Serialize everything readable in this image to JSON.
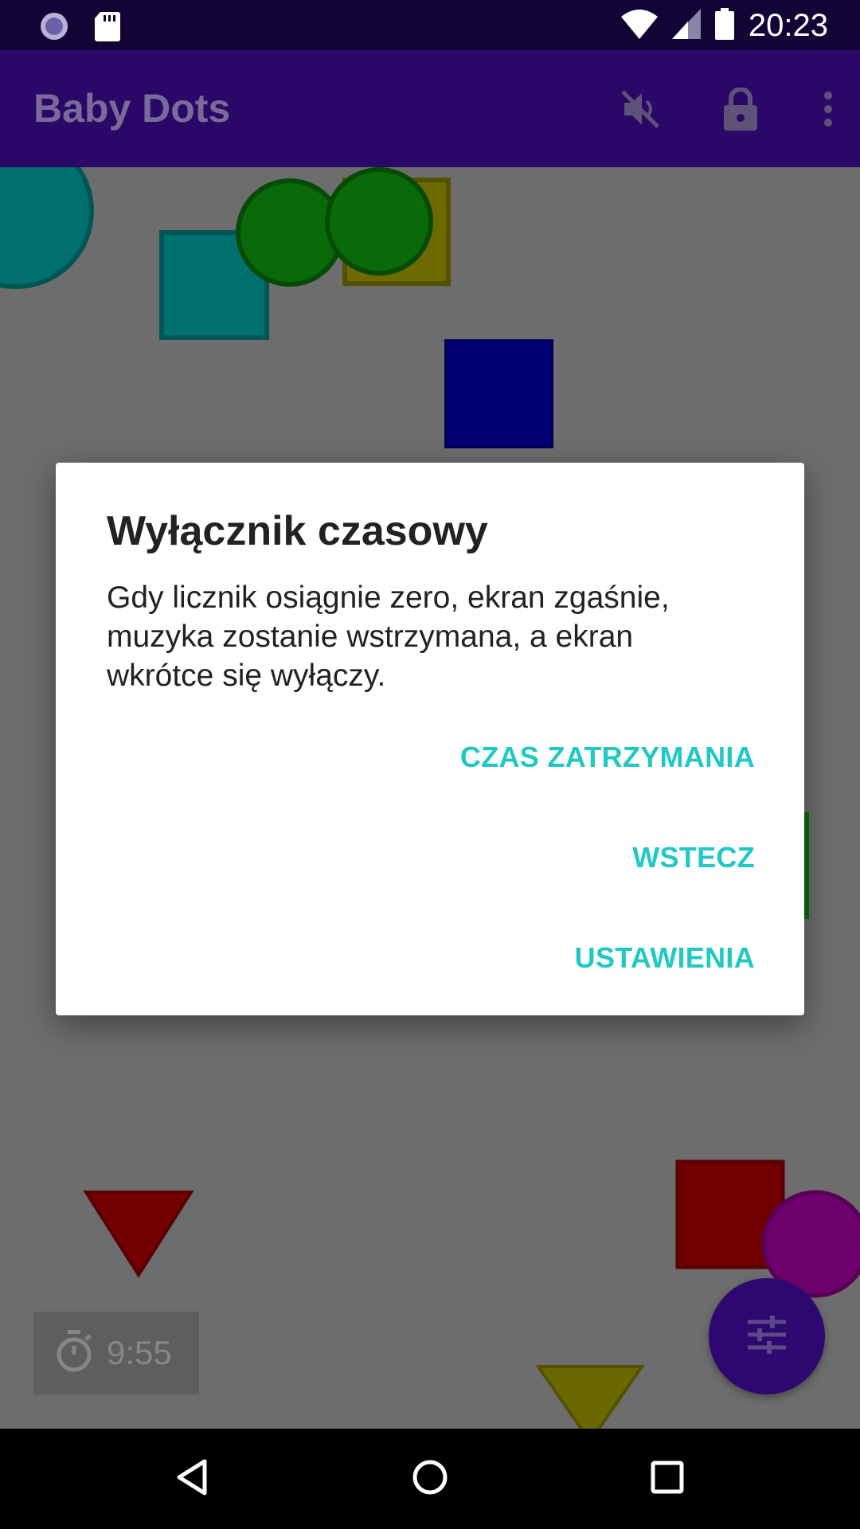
{
  "status_bar": {
    "time": "20:23",
    "icons": [
      "sync-icon",
      "sd-card-icon",
      "wifi-icon",
      "signal-icon",
      "battery-icon"
    ]
  },
  "app_bar": {
    "title": "Baby Dots",
    "actions": [
      "mute-icon",
      "lock-icon",
      "more-vert-icon"
    ]
  },
  "dialog": {
    "title": "Wyłącznik czasowy",
    "message": "Gdy licznik osiągnie zero, ekran zgaśnie, muzyka zostanie wstrzymana, a ekran wkrótce się wyłączy.",
    "buttons": {
      "stop_time": "CZAS ZATRZYMANIA",
      "back": "WSTECZ",
      "settings": "USTAWIENIA"
    }
  },
  "timer": {
    "value": "9:55",
    "icon": "stopwatch-icon"
  },
  "fab": {
    "icon": "tune-icon"
  },
  "nav_bar": {
    "icons": [
      "back-icon",
      "home-icon",
      "recents-icon"
    ]
  },
  "colors": {
    "accent": "#22c8c4",
    "app_bar": "#2a0868",
    "status_bar": "#120535",
    "background": "#6d6d6d"
  }
}
